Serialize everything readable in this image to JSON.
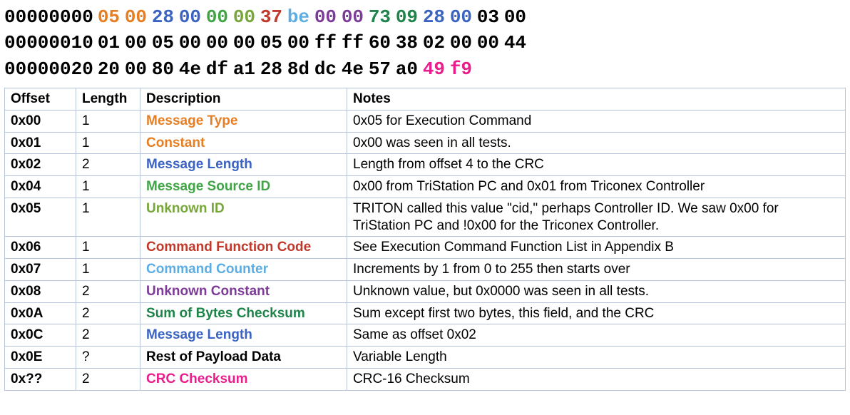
{
  "colors": {
    "orange": "#e77e22",
    "blue": "#3a63c2",
    "green1": "#3fa545",
    "olive": "#77a63a",
    "red": "#c0392b",
    "skyblue": "#5dade2",
    "purple": "#7d3c98",
    "green2": "#1e8449",
    "magenta": "#e91e8c",
    "black": "#000000"
  },
  "hex_lines": [
    {
      "addr": "00000000",
      "bytes": [
        {
          "v": "05",
          "c": "orange"
        },
        {
          "v": "00",
          "c": "orange"
        },
        {
          "v": "28",
          "c": "blue"
        },
        {
          "v": "00",
          "c": "blue"
        },
        {
          "v": "00",
          "c": "green1"
        },
        {
          "v": "00",
          "c": "olive"
        },
        {
          "v": "37",
          "c": "red"
        },
        {
          "v": "be",
          "c": "skyblue"
        },
        {
          "v": "00",
          "c": "purple"
        },
        {
          "v": "00",
          "c": "purple"
        },
        {
          "v": "73",
          "c": "green2"
        },
        {
          "v": "09",
          "c": "green2"
        },
        {
          "v": "28",
          "c": "blue"
        },
        {
          "v": "00",
          "c": "blue"
        },
        {
          "v": "03",
          "c": "black"
        },
        {
          "v": "00",
          "c": "black"
        }
      ]
    },
    {
      "addr": "00000010",
      "bytes": [
        {
          "v": "01",
          "c": "black"
        },
        {
          "v": "00",
          "c": "black"
        },
        {
          "v": "05",
          "c": "black"
        },
        {
          "v": "00",
          "c": "black"
        },
        {
          "v": "00",
          "c": "black"
        },
        {
          "v": "00",
          "c": "black"
        },
        {
          "v": "05",
          "c": "black"
        },
        {
          "v": "00",
          "c": "black"
        },
        {
          "v": "ff",
          "c": "black"
        },
        {
          "v": "ff",
          "c": "black"
        },
        {
          "v": "60",
          "c": "black"
        },
        {
          "v": "38",
          "c": "black"
        },
        {
          "v": "02",
          "c": "black"
        },
        {
          "v": "00",
          "c": "black"
        },
        {
          "v": "00",
          "c": "black"
        },
        {
          "v": "44",
          "c": "black"
        }
      ]
    },
    {
      "addr": "00000020",
      "bytes": [
        {
          "v": "20",
          "c": "black"
        },
        {
          "v": "00",
          "c": "black"
        },
        {
          "v": "80",
          "c": "black"
        },
        {
          "v": "4e",
          "c": "black"
        },
        {
          "v": "df",
          "c": "black"
        },
        {
          "v": "a1",
          "c": "black"
        },
        {
          "v": "28",
          "c": "black"
        },
        {
          "v": "8d",
          "c": "black"
        },
        {
          "v": "dc",
          "c": "black"
        },
        {
          "v": "4e",
          "c": "black"
        },
        {
          "v": "57",
          "c": "black"
        },
        {
          "v": "a0",
          "c": "black"
        },
        {
          "v": "49",
          "c": "magenta"
        },
        {
          "v": "f9",
          "c": "magenta"
        }
      ]
    }
  ],
  "table": {
    "headers": {
      "offset": "Offset",
      "length": "Length",
      "description": "Description",
      "notes": "Notes"
    },
    "rows": [
      {
        "offset": "0x00",
        "length": "1",
        "desc": "Message Type",
        "color": "orange",
        "notes": "0x05 for Execution Command"
      },
      {
        "offset": "0x01",
        "length": "1",
        "desc": "Constant",
        "color": "orange",
        "notes": "0x00 was seen in all tests."
      },
      {
        "offset": "0x02",
        "length": "2",
        "desc": "Message Length",
        "color": "blue",
        "notes": "Length from offset 4 to the CRC"
      },
      {
        "offset": "0x04",
        "length": "1",
        "desc": "Message Source ID",
        "color": "green1",
        "notes": "0x00 from TriStation PC and 0x01 from Triconex Controller"
      },
      {
        "offset": "0x05",
        "length": "1",
        "desc": "Unknown ID",
        "color": "olive",
        "notes": "TRITON called this value \"cid,\" perhaps Controller ID. We saw 0x00 for TriStation PC and !0x00 for the Triconex Controller."
      },
      {
        "offset": "0x06",
        "length": "1",
        "desc": "Command Function Code",
        "color": "red",
        "notes": "See Execution Command Function List in Appendix B"
      },
      {
        "offset": "0x07",
        "length": "1",
        "desc": "Command Counter",
        "color": "skyblue",
        "notes": "Increments by 1 from 0 to 255 then starts over"
      },
      {
        "offset": "0x08",
        "length": "2",
        "desc": "Unknown Constant",
        "color": "purple",
        "notes": "Unknown value, but 0x0000 was seen in all tests."
      },
      {
        "offset": "0x0A",
        "length": "2",
        "desc": "Sum of Bytes Checksum",
        "color": "green2",
        "notes": "Sum except first two bytes, this field, and the CRC"
      },
      {
        "offset": "0x0C",
        "length": "2",
        "desc": "Message Length",
        "color": "blue",
        "notes": "Same as offset 0x02"
      },
      {
        "offset": "0x0E",
        "length": "?",
        "desc": "Rest of Payload Data",
        "color": "black",
        "notes": "Variable Length"
      },
      {
        "offset": "0x??",
        "length": "2",
        "desc": "CRC Checksum",
        "color": "magenta",
        "notes": "CRC-16 Checksum"
      }
    ]
  }
}
